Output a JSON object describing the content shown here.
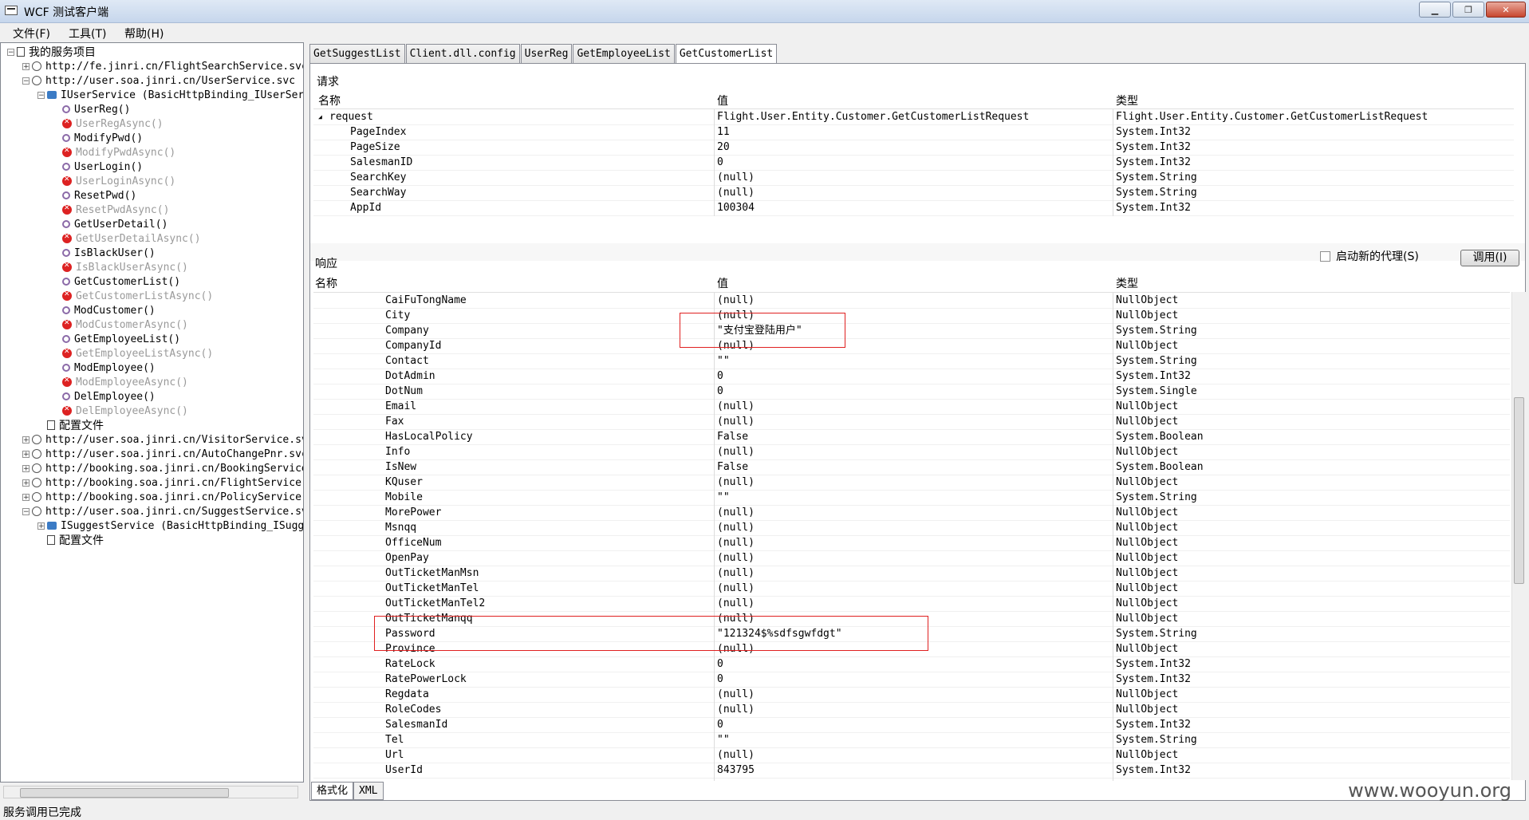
{
  "window": {
    "title": "WCF 测试客户端",
    "min_label": "▁",
    "max_label": "❐",
    "close_label": "✕"
  },
  "menu": [
    "文件(F)",
    "工具(T)",
    "帮助(H)"
  ],
  "tree": [
    {
      "label": "我的服务项目",
      "icon": "project-icon",
      "expander": "−",
      "indent": 0,
      "zh": true
    },
    {
      "label": "http://fe.jinri.cn/FlightSearchService.svc",
      "icon": "globe-icon",
      "expander": "+",
      "indent": 1
    },
    {
      "label": "http://user.soa.jinri.cn/UserService.svc",
      "icon": "globe-icon",
      "expander": "−",
      "indent": 1
    },
    {
      "label": "IUserService (BasicHttpBinding_IUserService)",
      "icon": "interface-icon",
      "expander": "−",
      "indent": 2
    },
    {
      "label": "UserReg()",
      "icon": "operation-icon",
      "indent": 3
    },
    {
      "label": "UserRegAsync()",
      "icon": "error-icon",
      "indent": 3,
      "dim": true
    },
    {
      "label": "ModifyPwd()",
      "icon": "operation-icon",
      "indent": 3
    },
    {
      "label": "ModifyPwdAsync()",
      "icon": "error-icon",
      "indent": 3,
      "dim": true
    },
    {
      "label": "UserLogin()",
      "icon": "operation-icon",
      "indent": 3
    },
    {
      "label": "UserLoginAsync()",
      "icon": "error-icon",
      "indent": 3,
      "dim": true
    },
    {
      "label": "ResetPwd()",
      "icon": "operation-icon",
      "indent": 3
    },
    {
      "label": "ResetPwdAsync()",
      "icon": "error-icon",
      "indent": 3,
      "dim": true
    },
    {
      "label": "GetUserDetail()",
      "icon": "operation-icon",
      "indent": 3
    },
    {
      "label": "GetUserDetailAsync()",
      "icon": "error-icon",
      "indent": 3,
      "dim": true
    },
    {
      "label": "IsBlackUser()",
      "icon": "operation-icon",
      "indent": 3
    },
    {
      "label": "IsBlackUserAsync()",
      "icon": "error-icon",
      "indent": 3,
      "dim": true
    },
    {
      "label": "GetCustomerList()",
      "icon": "operation-icon",
      "indent": 3
    },
    {
      "label": "GetCustomerListAsync()",
      "icon": "error-icon",
      "indent": 3,
      "dim": true
    },
    {
      "label": "ModCustomer()",
      "icon": "operation-icon",
      "indent": 3
    },
    {
      "label": "ModCustomerAsync()",
      "icon": "error-icon",
      "indent": 3,
      "dim": true
    },
    {
      "label": "GetEmployeeList()",
      "icon": "operation-icon",
      "indent": 3
    },
    {
      "label": "GetEmployeeListAsync()",
      "icon": "error-icon",
      "indent": 3,
      "dim": true
    },
    {
      "label": "ModEmployee()",
      "icon": "operation-icon",
      "indent": 3
    },
    {
      "label": "ModEmployeeAsync()",
      "icon": "error-icon",
      "indent": 3,
      "dim": true
    },
    {
      "label": "DelEmployee()",
      "icon": "operation-icon",
      "indent": 3
    },
    {
      "label": "DelEmployeeAsync()",
      "icon": "error-icon",
      "indent": 3,
      "dim": true
    },
    {
      "label": "配置文件",
      "icon": "file-icon",
      "indent": 2,
      "zh": true
    },
    {
      "label": "http://user.soa.jinri.cn/VisitorService.svc",
      "icon": "globe-icon",
      "expander": "+",
      "indent": 1
    },
    {
      "label": "http://user.soa.jinri.cn/AutoChangePnr.svc",
      "icon": "globe-icon",
      "expander": "+",
      "indent": 1
    },
    {
      "label": "http://booking.soa.jinri.cn/BookingService.svc",
      "icon": "globe-icon",
      "expander": "+",
      "indent": 1
    },
    {
      "label": "http://booking.soa.jinri.cn/FlightService.svc",
      "icon": "globe-icon",
      "expander": "+",
      "indent": 1
    },
    {
      "label": "http://booking.soa.jinri.cn/PolicyService.svc",
      "icon": "globe-icon",
      "expander": "+",
      "indent": 1
    },
    {
      "label": "http://user.soa.jinri.cn/SuggestService.svc",
      "icon": "globe-icon",
      "expander": "−",
      "indent": 1
    },
    {
      "label": "ISuggestService (BasicHttpBinding_ISuggestService)",
      "icon": "interface-icon",
      "expander": "+",
      "indent": 2
    },
    {
      "label": "配置文件",
      "icon": "file-icon",
      "indent": 2,
      "zh": true
    }
  ],
  "tabs": [
    "GetSuggestList",
    "Client.dll.config",
    "UserReg",
    "GetEmployeeList",
    "GetCustomerList"
  ],
  "request": {
    "label": "请求",
    "headers": {
      "name": "名称",
      "value": "值",
      "type": "类型"
    },
    "rows": [
      {
        "name": "request",
        "value": "Flight.User.Entity.Customer.GetCustomerListRequest",
        "type": "Flight.User.Entity.Customer.GetCustomerListRequest",
        "root": true
      },
      {
        "name": "PageIndex",
        "value": "11",
        "type": "System.Int32"
      },
      {
        "name": "PageSize",
        "value": "20",
        "type": "System.Int32"
      },
      {
        "name": "SalesmanID",
        "value": "0",
        "type": "System.Int32"
      },
      {
        "name": "SearchKey",
        "value": "(null)",
        "type": "System.String"
      },
      {
        "name": "SearchWay",
        "value": "(null)",
        "type": "System.String"
      },
      {
        "name": "AppId",
        "value": "100304",
        "type": "System.Int32"
      }
    ]
  },
  "response": {
    "label": "响应",
    "new_proxy_label": "启动新的代理(S)",
    "invoke_label": "调用(I)",
    "headers": {
      "name": "名称",
      "value": "值",
      "type": "类型"
    },
    "rows": [
      {
        "name": "CaiFuTongName",
        "value": "(null)",
        "type": "NullObject"
      },
      {
        "name": "City",
        "value": "(null)",
        "type": "NullObject"
      },
      {
        "name": "Company",
        "value": "\"支付宝登陆用户\"",
        "type": "System.String"
      },
      {
        "name": "CompanyId",
        "value": "(null)",
        "type": "NullObject"
      },
      {
        "name": "Contact",
        "value": "\"\"",
        "type": "System.String"
      },
      {
        "name": "DotAdmin",
        "value": "0",
        "type": "System.Int32"
      },
      {
        "name": "DotNum",
        "value": "0",
        "type": "System.Single"
      },
      {
        "name": "Email",
        "value": "(null)",
        "type": "NullObject"
      },
      {
        "name": "Fax",
        "value": "(null)",
        "type": "NullObject"
      },
      {
        "name": "HasLocalPolicy",
        "value": "False",
        "type": "System.Boolean"
      },
      {
        "name": "Info",
        "value": "(null)",
        "type": "NullObject"
      },
      {
        "name": "IsNew",
        "value": "False",
        "type": "System.Boolean"
      },
      {
        "name": "KQuser",
        "value": "(null)",
        "type": "NullObject"
      },
      {
        "name": "Mobile",
        "value": "\"\"",
        "type": "System.String"
      },
      {
        "name": "MorePower",
        "value": "(null)",
        "type": "NullObject"
      },
      {
        "name": "Msnqq",
        "value": "(null)",
        "type": "NullObject"
      },
      {
        "name": "OfficeNum",
        "value": "(null)",
        "type": "NullObject"
      },
      {
        "name": "OpenPay",
        "value": "(null)",
        "type": "NullObject"
      },
      {
        "name": "OutTicketManMsn",
        "value": "(null)",
        "type": "NullObject"
      },
      {
        "name": "OutTicketManTel",
        "value": "(null)",
        "type": "NullObject"
      },
      {
        "name": "OutTicketManTel2",
        "value": "(null)",
        "type": "NullObject"
      },
      {
        "name": "OutTicketManqq",
        "value": "(null)",
        "type": "NullObject"
      },
      {
        "name": "Password",
        "value": "\"121324$%sdfsgwfdgt\"",
        "type": "System.String"
      },
      {
        "name": "Province",
        "value": "(null)",
        "type": "NullObject"
      },
      {
        "name": "RateLock",
        "value": "0",
        "type": "System.Int32"
      },
      {
        "name": "RatePowerLock",
        "value": "0",
        "type": "System.Int32"
      },
      {
        "name": "Regdata",
        "value": "(null)",
        "type": "NullObject"
      },
      {
        "name": "RoleCodes",
        "value": "(null)",
        "type": "NullObject"
      },
      {
        "name": "SalesmanId",
        "value": "0",
        "type": "System.Int32"
      },
      {
        "name": "Tel",
        "value": "\"\"",
        "type": "System.String"
      },
      {
        "name": "Url",
        "value": "(null)",
        "type": "NullObject"
      },
      {
        "name": "UserId",
        "value": "843795",
        "type": "System.Int32"
      }
    ]
  },
  "bottom_tabs": [
    "格式化",
    "XML"
  ],
  "status": "服务调用已完成",
  "watermark": "www.wooyun.org",
  "colors": {
    "highlight_box": "#e02020"
  }
}
